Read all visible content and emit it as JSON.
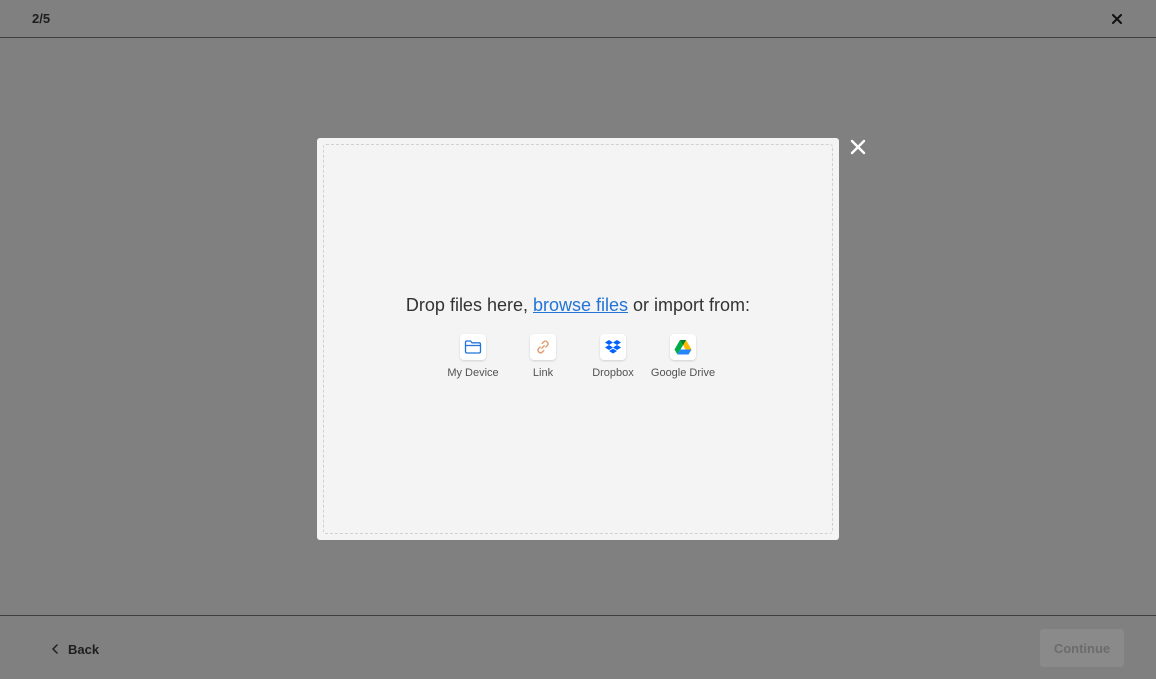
{
  "header": {
    "step": "2/5",
    "close_icon": "close-icon"
  },
  "modal": {
    "drop_prefix": "Drop files here, ",
    "browse_link": "browse files",
    "drop_suffix": " or import from:",
    "close_icon": "close-icon",
    "sources": [
      {
        "label": "My Device",
        "icon": "folder-icon"
      },
      {
        "label": "Link",
        "icon": "link-icon"
      },
      {
        "label": "Dropbox",
        "icon": "dropbox-icon"
      },
      {
        "label": "Google Drive",
        "icon": "google-drive-icon"
      }
    ]
  },
  "footer": {
    "back_label": "Back",
    "continue_label": "Continue"
  },
  "colors": {
    "link": "#2275d7",
    "overlay": "#808080",
    "dropbox": "#0061fe"
  }
}
